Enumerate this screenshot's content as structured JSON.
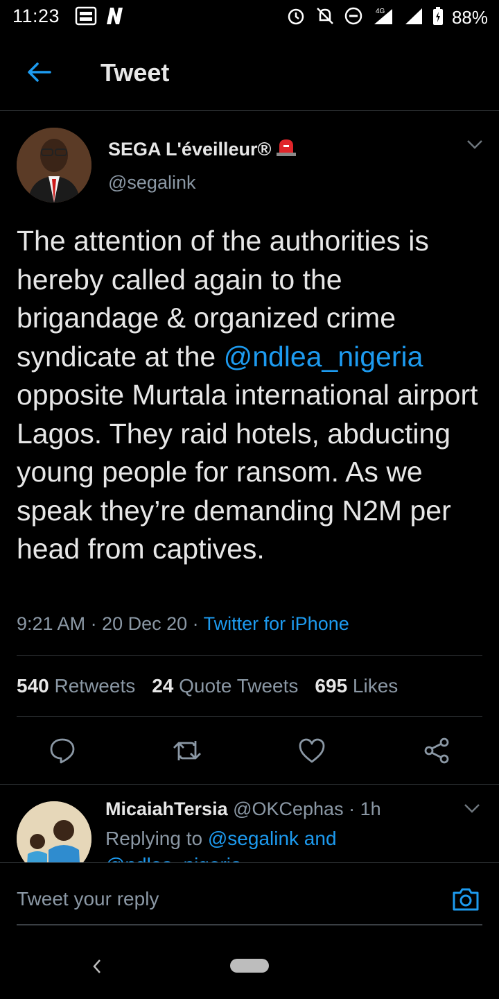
{
  "status_bar": {
    "time": "11:23",
    "battery": "88%",
    "network": "4G"
  },
  "header": {
    "title": "Tweet"
  },
  "tweet": {
    "author_name": "SEGA L'éveilleur®",
    "author_handle": "@segalink",
    "text_before": "The attention of the authorities is hereby called again to the brigandage & organized crime syndicate at the ",
    "mention": "@ndlea_nigeria",
    "text_after": " opposite Murtala international airport Lagos. They raid hotels, abducting young people for ransom. As we speak they’re demanding N2M per head from captives.",
    "timestamp": "9:21 AM · 20 Dec 20 · ",
    "client": "Twitter for iPhone",
    "stats": {
      "retweets_count": "540",
      "retweets_label": "Retweets",
      "quotes_count": "24",
      "quotes_label": "Quote Tweets",
      "likes_count": "695",
      "likes_label": "Likes"
    },
    "icons": [
      "reply-icon",
      "retweet-icon",
      "like-icon",
      "share-icon"
    ]
  },
  "reply": {
    "name": "MicaiahTersia",
    "meta": " @OKCephas · 1h",
    "replying_prefix": "Replying to ",
    "replying_to": "@segalink and",
    "replying_more": "@ndlea_nigeria"
  },
  "compose": {
    "placeholder": "Tweet your reply"
  },
  "colors": {
    "accent": "#1d9bf0",
    "background": "#000000",
    "muted": "#8b98a5"
  }
}
